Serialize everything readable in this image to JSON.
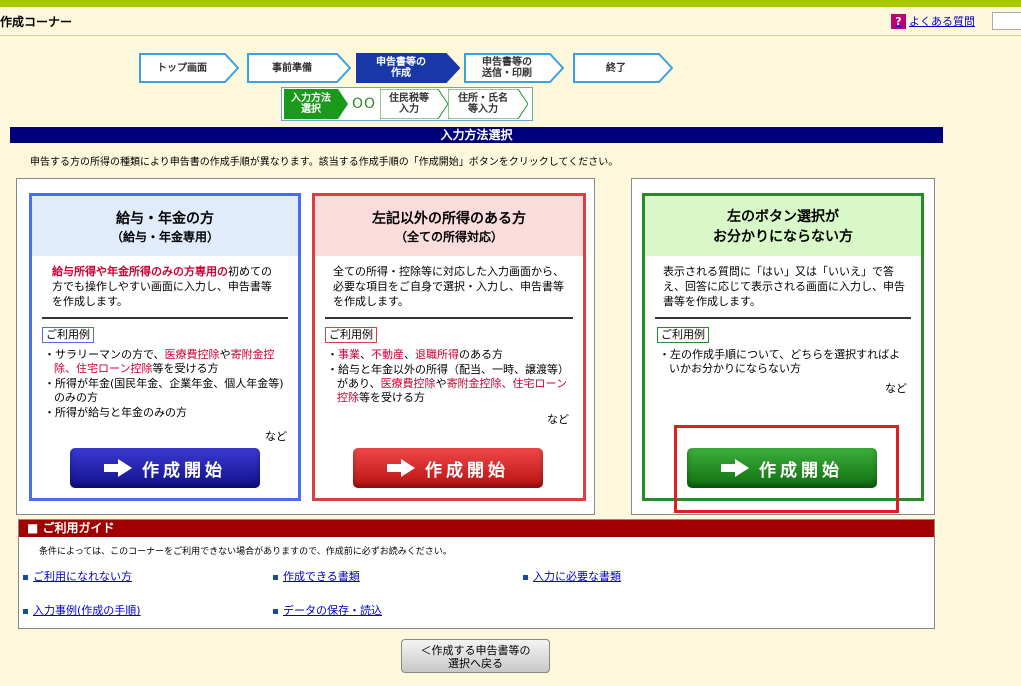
{
  "header": {
    "title": "作成コーナー",
    "faq_label": "よくある質問",
    "faq_icon": "question-icon"
  },
  "steps": [
    {
      "label": "トップ画面",
      "active": false
    },
    {
      "label": "事前準備",
      "active": false
    },
    {
      "label": "申告書等の\n作成",
      "active": true
    },
    {
      "label": "申告書等の\n送信・印刷",
      "active": false
    },
    {
      "label": "終了",
      "active": false
    }
  ],
  "substeps": [
    {
      "label": "入力方法\n選択",
      "active": true
    },
    {
      "label": "住民税等\n入力",
      "active": false
    },
    {
      "label": "住所・氏名\n等入力",
      "active": false
    }
  ],
  "section": {
    "title": "入力方法選択",
    "instruction": "申告する方の所得の種類により申告書の作成手順が異なります。該当する作成手順の「作成開始」ボタンをクリックしてください。"
  },
  "cards": {
    "salary": {
      "title1": "給与・年金の方",
      "title2": "（給与・年金専用）",
      "desc_red": "給与所得や年金所得のみの方専用の",
      "desc_rest": "初めての方でも操作しやすい画面に入力し、申告書等を作成します。",
      "usage_label": "ご利用例",
      "usage": [
        {
          "pre": "・サラリーマンの方で、",
          "red1": "医療費控除",
          "mid": "や",
          "red2": "寄附金控除、住宅ローン控除",
          "post": "等を受ける方"
        },
        {
          "pre": "・所得が年金(国民年金、企業年金、個人年金等)のみの方"
        },
        {
          "pre": "・所得が給与と年金のみの方"
        }
      ],
      "nado": "など",
      "button": "作成開始"
    },
    "other": {
      "title1": "左記以外の所得のある方",
      "title2": "（全ての所得対応）",
      "desc": "全ての所得・控除等に対応した入力画面から、必要な項目をご自身で選択・入力し、申告書等を作成します。",
      "usage_label": "ご利用例",
      "usage1": {
        "pre": "・",
        "red1": "事業",
        "sep1": "、",
        "red2": "不動産",
        "sep2": "、",
        "red3": "退職所得",
        "post": "のある方"
      },
      "usage2": {
        "pre": "・給与と年金以外の所得（配当、一時、譲渡等）があり、",
        "red1": "医療費控除",
        "mid": "や",
        "red2": "寄附金控除、住宅ローン控除",
        "post": "等を受ける方"
      },
      "nado": "など",
      "button": "作成開始"
    },
    "unsure": {
      "title1": "左のボタン選択が",
      "title2": "お分かりにならない方",
      "desc": "表示される質問に「はい」又は「いいえ」で答え、回答に応じて表示される画面に入力し、申告書等を作成します。",
      "usage_label": "ご利用例",
      "usage": "・左の作成手順について、どちらを選択すればよいかお分かりにならない方",
      "nado": "など",
      "button": "作成開始"
    }
  },
  "guide": {
    "title": "■ ご利用ガイド",
    "note": "条件によっては、このコーナーをご利用できない場合がありますので、作成前に必ずお読みください。",
    "links": [
      "ご利用になれない方",
      "作成できる書類",
      "入力に必要な書類",
      "入力事例(作成の手順)",
      "データの保存・読込"
    ]
  },
  "back_button": "＜作成する申告書等の\n選択へ戻る",
  "colors": {
    "navy": "#00007a",
    "blue": "#4a6ef0",
    "red": "#d84040",
    "green": "#2a8a2a",
    "guide_red": "#a00000"
  }
}
